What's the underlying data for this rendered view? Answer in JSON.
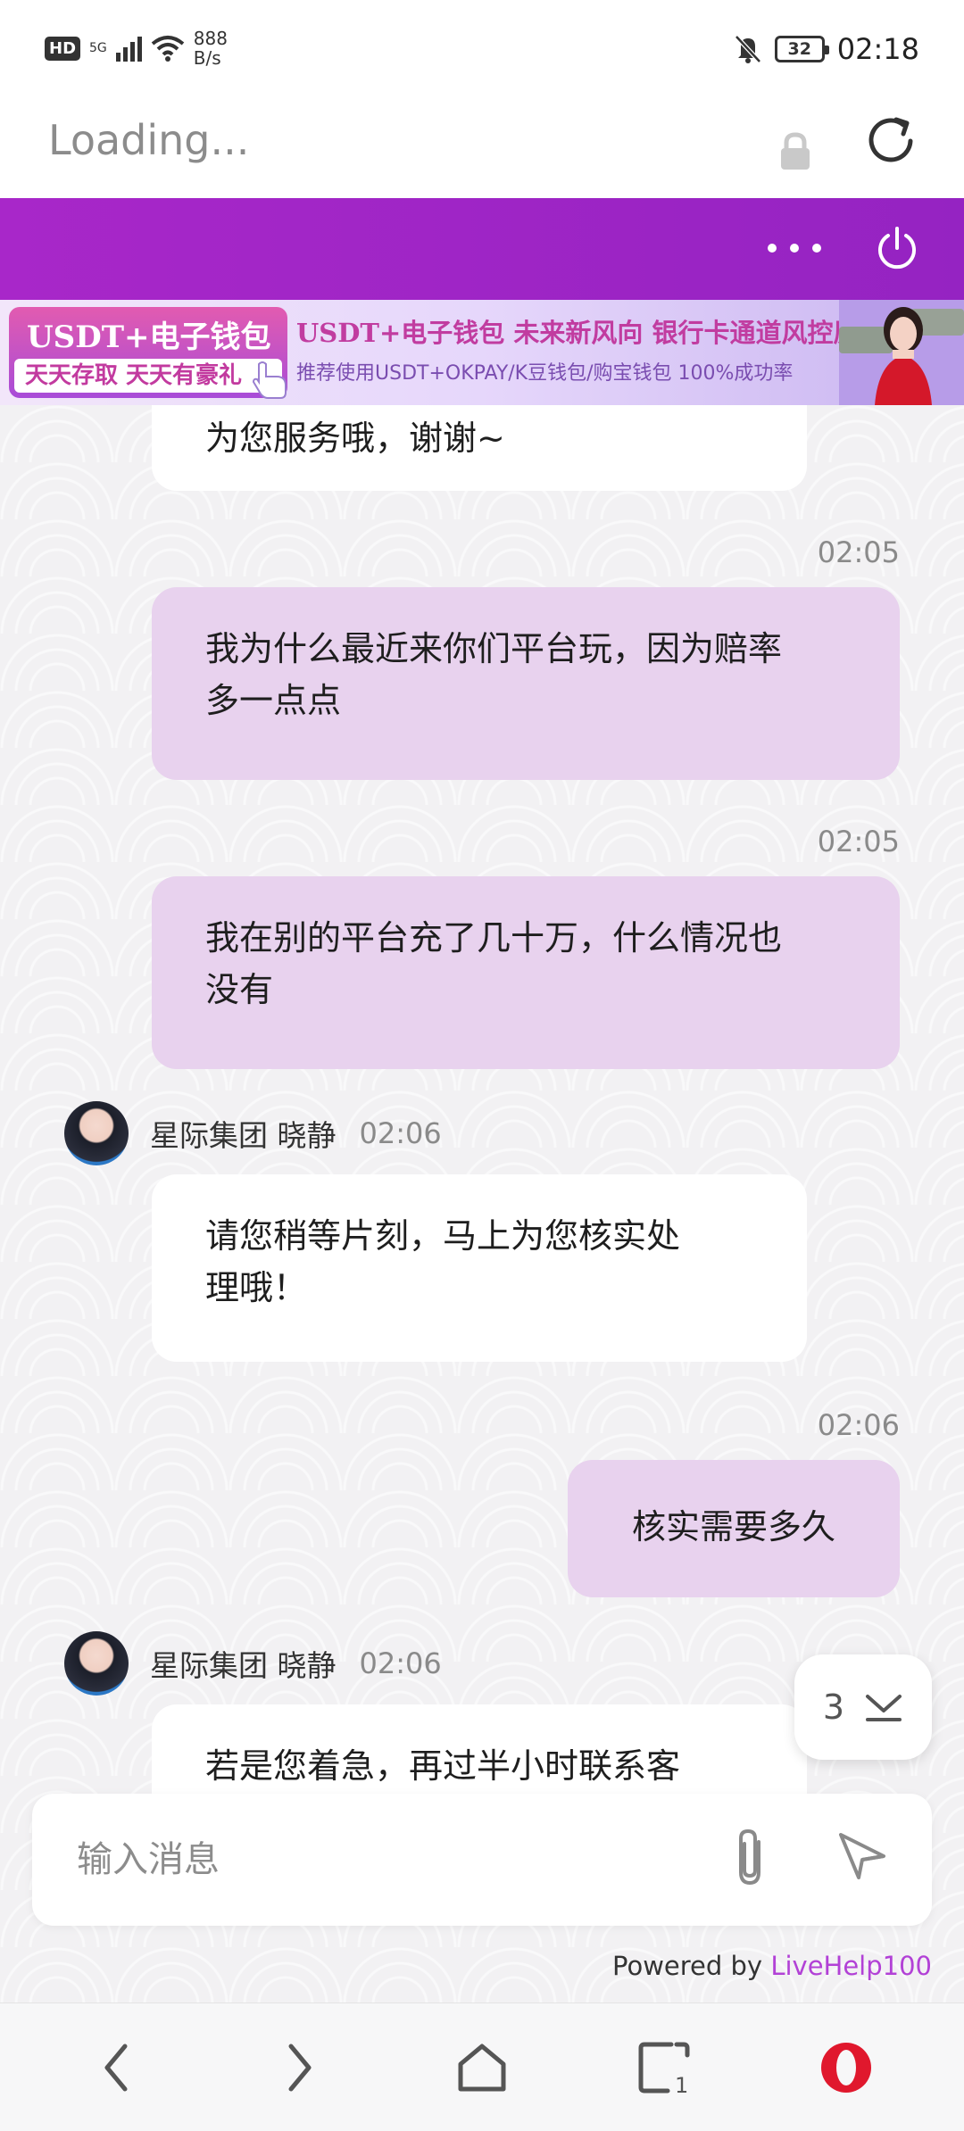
{
  "status_bar": {
    "hd": "HD",
    "network": "5G",
    "net_speed_value": "888",
    "net_speed_unit": "B/s",
    "battery": "32",
    "time": "02:18"
  },
  "browser": {
    "page_status": "Loading..."
  },
  "banner": {
    "box_title": "USDT+电子钱包",
    "box_sub": "天天存取 天天有豪礼",
    "line1": "USDT+电子钱包  未来新风向  银行卡通道风控厉害",
    "line2": "推荐使用USDT+OKPAY/K豆钱包/购宝钱包   100%成功率"
  },
  "messages": [
    {
      "type": "in",
      "text": "为您服务哦，谢谢~"
    },
    {
      "type": "out",
      "time": "02:05",
      "text_lines": [
        "我为什么最近来你们平台玩，因为赔率",
        "多一点点"
      ]
    },
    {
      "type": "out",
      "time": "02:05",
      "text_lines": [
        "我在别的平台充了几十万，什么情况也",
        "没有"
      ]
    },
    {
      "type": "in",
      "sender": "星际集团 晓静",
      "time": "02:06",
      "text_lines": [
        "请您稍等片刻，马上为您核实处",
        "理哦！"
      ]
    },
    {
      "type": "out",
      "time": "02:06",
      "text": "核实需要多久"
    },
    {
      "type": "in",
      "sender": "星际集团 晓静",
      "time": "02:06",
      "text": "若是您着急，再过半小时联系客"
    }
  ],
  "scroll_down": {
    "unread_count": "3"
  },
  "composer": {
    "placeholder": "输入消息"
  },
  "footer": {
    "powered_prefix": "Powered by ",
    "powered_brand": "LiveHelp100"
  },
  "colors": {
    "header_purple": "#a827c9",
    "outgoing_bubble": "#e8d2ee",
    "brand_link": "#b241d6",
    "opera_red": "#e0182d"
  },
  "icons": {
    "lock": "lock-icon",
    "reload": "reload-icon",
    "more": "more-icon",
    "power": "power-icon",
    "attach": "paperclip-icon",
    "send": "send-icon",
    "scroll_down": "chevron-down-icon",
    "back": "back-icon",
    "forward": "forward-icon",
    "home": "home-icon",
    "tabs": "tabs-icon",
    "opera_menu": "opera-icon"
  },
  "bottom_nav": {
    "tabs_count": "1"
  }
}
